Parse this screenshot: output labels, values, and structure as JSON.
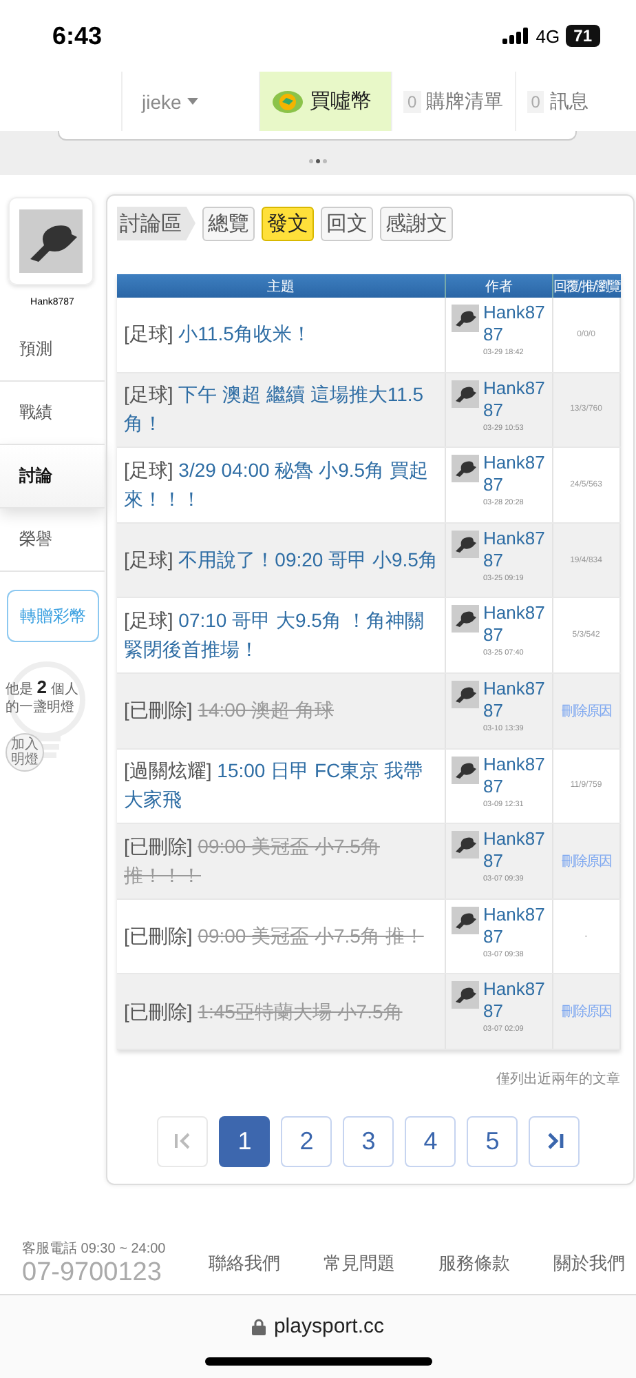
{
  "status_bar": {
    "time": "6:43",
    "network": "4G",
    "battery": "71"
  },
  "top_nav": {
    "user": "jieke",
    "buy": "買噓幣",
    "cart": {
      "count": "0",
      "label": "購牌清單"
    },
    "messages": {
      "count": "0",
      "label": "訊息"
    }
  },
  "sidebar": {
    "username": "Hank8787",
    "items": [
      {
        "label": "預測",
        "selected": false
      },
      {
        "label": "戰績",
        "selected": false
      },
      {
        "label": "討論",
        "selected": true
      },
      {
        "label": "榮譽",
        "selected": false
      }
    ],
    "gift_button": "轉贈彩幣",
    "light_prefix": "他是",
    "light_count": "2",
    "light_suffix": "個人的一盞明燈",
    "join_button": "加入明燈"
  },
  "tabs": {
    "section": "討論區",
    "items": [
      {
        "label": "總覽",
        "selected": false
      },
      {
        "label": "發文",
        "selected": true
      },
      {
        "label": "回文",
        "selected": false
      },
      {
        "label": "感謝文",
        "selected": false
      }
    ]
  },
  "table": {
    "columns": [
      "主題",
      "作者",
      "回覆/推/瀏覽"
    ],
    "rows": [
      {
        "tag": "[足球]",
        "title": "小11.5角收米！",
        "deleted": false,
        "author": "Hank8787",
        "date": "03-29 18:42",
        "stats": "0/0/0",
        "stats_link": false
      },
      {
        "tag": "[足球]",
        "title": "下午 澳超 繼續 這場推大11.5角！",
        "deleted": false,
        "author": "Hank8787",
        "date": "03-29 10:53",
        "stats": "13/3/760",
        "stats_link": false
      },
      {
        "tag": "[足球]",
        "title": "3/29 04:00 秘魯 小9.5角 買起來！！！",
        "deleted": false,
        "author": "Hank8787",
        "date": "03-28 20:28",
        "stats": "24/5/563",
        "stats_link": false
      },
      {
        "tag": "[足球]",
        "title": "不用說了！09:20 哥甲 小9.5角",
        "deleted": false,
        "author": "Hank8787",
        "date": "03-25 09:19",
        "stats": "19/4/834",
        "stats_link": false
      },
      {
        "tag": "[足球]",
        "title": "07:10 哥甲 大9.5角 ！角神關緊閉後首推場！",
        "deleted": false,
        "author": "Hank8787",
        "date": "03-25 07:40",
        "stats": "5/3/542",
        "stats_link": false
      },
      {
        "tag": "[已刪除]",
        "title": "14:00 澳超 角球",
        "deleted": true,
        "author": "Hank8787",
        "date": "03-10 13:39",
        "stats": "刪除原因",
        "stats_link": true
      },
      {
        "tag": "[過關炫耀]",
        "title": "15:00 日甲 FC東京 我帶大家飛",
        "deleted": false,
        "author": "Hank8787",
        "date": "03-09 12:31",
        "stats": "11/9/759",
        "stats_link": false
      },
      {
        "tag": "[已刪除]",
        "title": "09:00 美冠盃 小7.5角推！！！",
        "deleted": true,
        "author": "Hank8787",
        "date": "03-07 09:39",
        "stats": "刪除原因",
        "stats_link": true
      },
      {
        "tag": "[已刪除]",
        "title": "09:00 美冠盃 小7.5角 推！",
        "deleted": true,
        "author": "Hank8787",
        "date": "03-07 09:38",
        "stats": "-",
        "stats_link": false
      },
      {
        "tag": "[已刪除]",
        "title": "1:45亞特蘭大場 小7.5角",
        "deleted": true,
        "author": "Hank8787",
        "date": "03-07 02:09",
        "stats": "刪除原因",
        "stats_link": true
      }
    ]
  },
  "note": "僅列出近兩年的文章",
  "pagination": {
    "pages": [
      {
        "label": "1",
        "selected": true
      },
      {
        "label": "2",
        "selected": false
      },
      {
        "label": "3",
        "selected": false
      },
      {
        "label": "4",
        "selected": false
      },
      {
        "label": "5",
        "selected": false
      }
    ],
    "first_disabled": true,
    "last_disabled": false
  },
  "footer": {
    "hotline_label": "客服電話",
    "hours": "09:30 ~ 24:00",
    "phone": "07-9700123",
    "links": [
      "聯絡我們",
      "常見問題",
      "服務條款",
      "關於我們"
    ]
  },
  "browser": {
    "url": "playsport.cc"
  }
}
